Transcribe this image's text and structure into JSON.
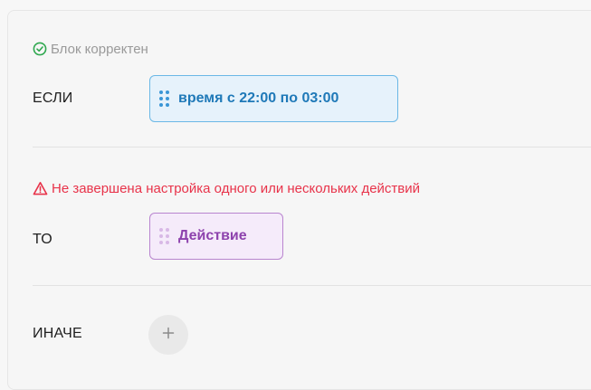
{
  "block": {
    "status_ok": {
      "text": "Блок корректен",
      "icon": "check-circle-icon",
      "color": "#2fa84f"
    },
    "if_section": {
      "label": "ЕСЛИ",
      "condition": {
        "text": "время с 22:00 по 03:00",
        "icon": "drag-handle-icon",
        "accent": "#1f79b8"
      }
    },
    "warning": {
      "text": "Не завершена настройка одного или нескольких действий",
      "icon": "warning-triangle-icon",
      "color": "#e8334a"
    },
    "then_section": {
      "label": "ТО",
      "action": {
        "text": "Действие",
        "icon": "drag-handle-icon",
        "accent": "#8d42ad"
      }
    },
    "else_section": {
      "label": "ИНАЧЕ",
      "add_icon": "plus-icon"
    }
  }
}
